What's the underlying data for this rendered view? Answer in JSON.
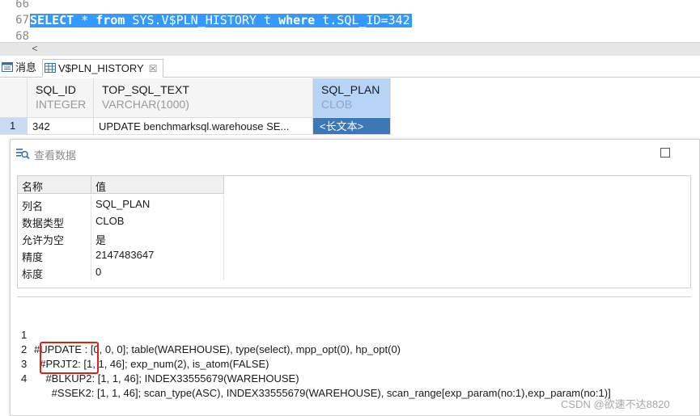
{
  "editor": {
    "lines": [
      {
        "num": "66",
        "text": ""
      },
      {
        "num": "67",
        "text": ""
      },
      {
        "num": "68",
        "text": ""
      }
    ],
    "query": {
      "kw_select": "SELECT",
      "star": " * ",
      "kw_from": "from",
      "table": " SYS.V$PLN_HISTORY t ",
      "kw_where": "where",
      "cond": " t.SQL_ID=342"
    },
    "scroll_left": "<"
  },
  "tabs": {
    "messages": "消息",
    "result": "V$PLN_HISTORY",
    "result_close": "☒"
  },
  "grid": {
    "columns": [
      {
        "name": "SQL_ID",
        "type": "INTEGER"
      },
      {
        "name": "TOP_SQL_TEXT",
        "type": "VARCHAR(1000)"
      },
      {
        "name": "SQL_PLAN",
        "type": "CLOB"
      }
    ],
    "rows": [
      {
        "num": "1",
        "cells": [
          "342",
          "UPDATE benchmarksql.warehouse SE...",
          "<长文本>"
        ]
      }
    ]
  },
  "dialog": {
    "title": "查看数据",
    "props_headers": [
      "名称",
      "值"
    ],
    "props": [
      {
        "key": "列名",
        "value": "SQL_PLAN"
      },
      {
        "key": "数据类型",
        "value": "CLOB"
      },
      {
        "key": "允许为空",
        "value": "是"
      },
      {
        "key": "精度",
        "value": "2147483647"
      },
      {
        "key": "标度",
        "value": "0"
      }
    ],
    "plan_lines": [
      {
        "num": "1",
        "text": "#UPDATE : [0, 0, 0]; table(WAREHOUSE), type(select), mpp_opt(0), hp_opt(0)"
      },
      {
        "num": "2",
        "text": "  #PRJT2: [1, 1, 46]; exp_num(2), is_atom(FALSE)"
      },
      {
        "num": "3",
        "text": "    #BLKUP2: [1, 1, 46]; INDEX33555679(WAREHOUSE)"
      },
      {
        "num": "4",
        "text": "      #SSEK2: [1, 1, 46]; scan_type(ASC), INDEX33555679(WAREHOUSE), scan_range[exp_param(no:1),exp_param(no:1)]"
      }
    ]
  },
  "watermark": "CSDN @欲速不达8820",
  "colors": {
    "selection": "#3399ff",
    "active_header": "#b7d4f7",
    "active_cell": "#3d77b8",
    "highlight_box": "#e0201b"
  }
}
